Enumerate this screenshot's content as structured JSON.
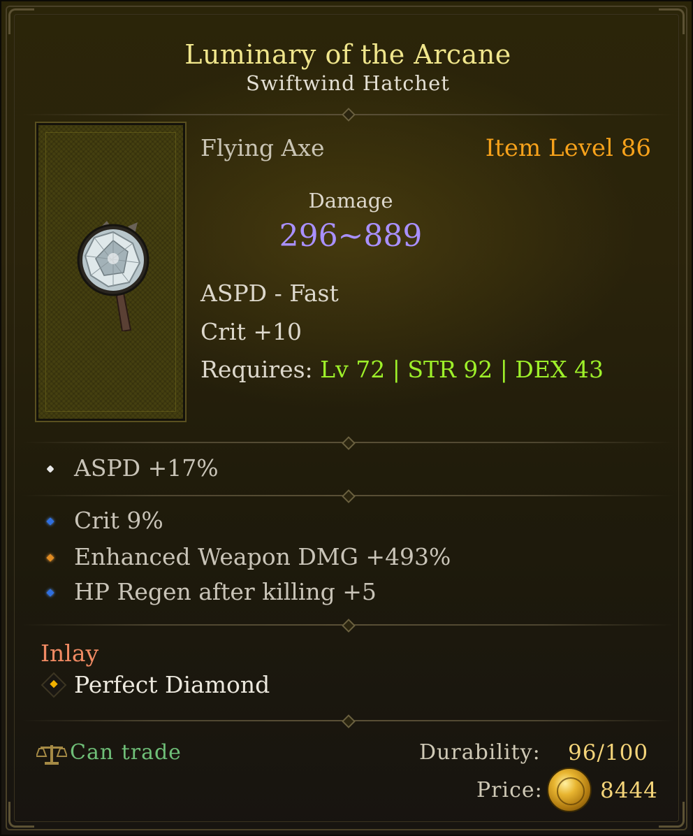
{
  "item": {
    "name": "Luminary of the Arcane",
    "base_name": "Swiftwind Hatchet",
    "type": "Flying Axe",
    "item_level": "Item Level 86",
    "damage_label": "Damage",
    "damage_value": "296~889",
    "aspd": "ASPD - Fast",
    "crit": "Crit +10",
    "requires_label": "Requires:",
    "req_level": "Lv 72",
    "req_sep": "|",
    "req_str": "STR 92",
    "req_dex": "DEX 43"
  },
  "base_affixes": [
    {
      "text": "ASPD +17%",
      "bullet": "white"
    }
  ],
  "magic_affixes": [
    {
      "text": "Crit 9%",
      "bullet": "blue"
    },
    {
      "text": "Enhanced Weapon DMG +493%",
      "bullet": "orange"
    },
    {
      "text": "HP Regen after killing +5",
      "bullet": "blue"
    }
  ],
  "inlay": {
    "heading": "Inlay",
    "gem": "Perfect Diamond",
    "gem_icon": "gem-socket-icon"
  },
  "footer": {
    "trade_icon": "scales-icon",
    "trade": "Can trade",
    "durability_label": "Durability:",
    "durability_value": "96/100",
    "durability_current": 96,
    "durability_max": 100,
    "price_label": "Price:",
    "price_icon": "gold-coin-icon",
    "price_value": "8444"
  },
  "colors": {
    "title": "#f0e68c",
    "item_level": "#f7a21b",
    "damage": "#a990ff",
    "requirement_met": "#9ef02a",
    "inlay_heading": "#f08a63",
    "tradeable": "#6fbf78",
    "currency_value": "#f5d57a"
  }
}
